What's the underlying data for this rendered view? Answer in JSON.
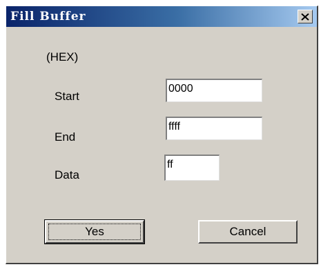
{
  "window": {
    "title": "Fill Buffer",
    "close_icon": "close-icon"
  },
  "form": {
    "format_label": "(HEX)",
    "start_label": "Start",
    "start_value": "0000",
    "end_label": "End",
    "end_value": "ffff",
    "data_label": "Data",
    "data_value": "ff"
  },
  "buttons": {
    "yes_label": "Yes",
    "cancel_label": "Cancel"
  },
  "colors": {
    "titlebar_start": "#0a246a",
    "titlebar_end": "#a6caf0",
    "dialog_face": "#d4d0c8"
  }
}
